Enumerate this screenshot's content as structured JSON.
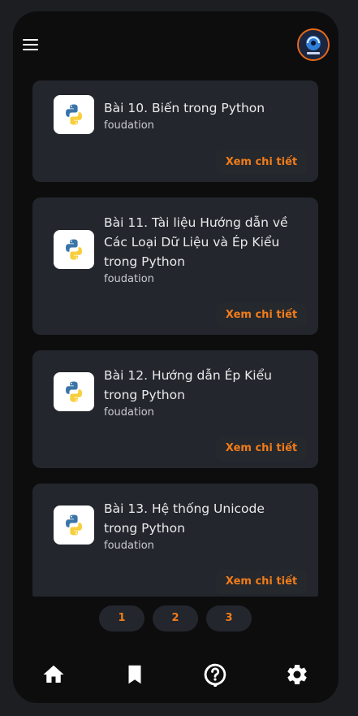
{
  "header": {
    "menu_icon": "menu-icon",
    "avatar_icon": "avatar-icon"
  },
  "lessons": [
    {
      "title": "Bài 10. Biến trong Python",
      "category": "foudation",
      "action": "Xem chi tiết",
      "icon": "python-logo-icon"
    },
    {
      "title": "Bài 11. Tài liệu Hướng dẫn về Các Loại Dữ Liệu và Ép Kiểu trong Python",
      "category": "foudation",
      "action": "Xem chi tiết",
      "icon": "python-logo-icon"
    },
    {
      "title": "Bài 12. Hướng dẫn Ép Kiểu trong Python",
      "category": "foudation",
      "action": "Xem chi tiết",
      "icon": "python-logo-icon"
    },
    {
      "title": "Bài 13. Hệ thống Unicode trong Python",
      "category": "foudation",
      "action": "Xem chi tiết",
      "icon": "python-logo-icon"
    }
  ],
  "pagination": {
    "pages": [
      "1",
      "2",
      "3"
    ]
  },
  "bottom_nav": {
    "items": [
      "home-icon",
      "bookmark-icon",
      "help-icon",
      "settings-icon"
    ]
  },
  "colors": {
    "accent": "#f07c1a",
    "card": "#23262c",
    "background": "#0d0d0e"
  }
}
